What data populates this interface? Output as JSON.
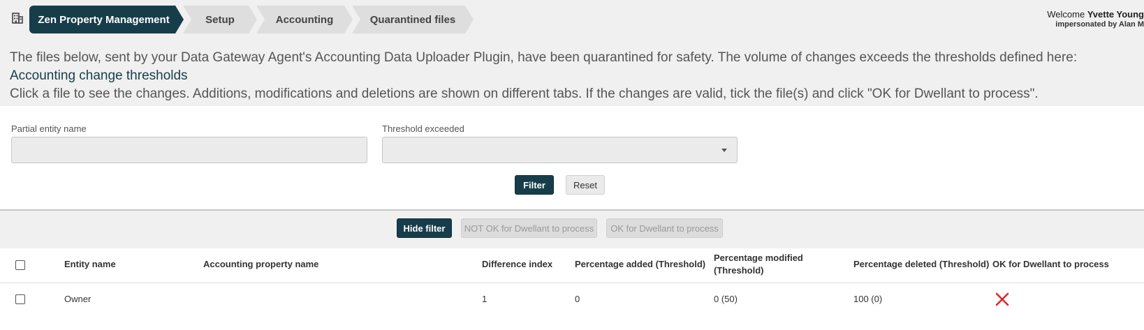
{
  "breadcrumb": {
    "items": [
      {
        "label": "Zen Property Management"
      },
      {
        "label": "Setup"
      },
      {
        "label": "Accounting"
      },
      {
        "label": "Quarantined files"
      }
    ]
  },
  "user": {
    "welcome_prefix": "Welcome",
    "name": "Yvette Young",
    "impersonated": "impersonated by Alan M"
  },
  "info": {
    "line1": "The files below, sent by your Data Gateway Agent's Accounting Data Uploader Plugin, have been quarantined for safety. The volume of changes exceeds the thresholds defined here:",
    "link": "Accounting change thresholds",
    "line2": "Click a file to see the changes. Additions, modifications and deletions are shown on different tabs. If the changes are valid, tick the file(s) and click \"OK for Dwellant to process\"."
  },
  "filter": {
    "entity_label": "Partial entity name",
    "entity_value": "",
    "threshold_label": "Threshold exceeded",
    "threshold_value": "",
    "filter_button": "Filter",
    "reset_button": "Reset"
  },
  "toolbar": {
    "hide_filter": "Hide filter",
    "not_ok": "NOT OK for Dwellant to process",
    "ok": "OK for Dwellant to process"
  },
  "table": {
    "columns": [
      "Entity name",
      "Accounting property name",
      "Difference index",
      "Percentage added (Threshold)",
      "Percentage modified (Threshold)",
      "Percentage deleted (Threshold)",
      "OK for Dwellant to process"
    ],
    "rows": [
      {
        "entity": "Owner",
        "property": "",
        "difference_index": "1",
        "added": "0",
        "modified": "0 (50)",
        "deleted": "100 (0)",
        "ok": false,
        "ok_icon": "red-x-icon"
      }
    ]
  },
  "colors": {
    "primary": "#173d4a",
    "danger": "#e0262b"
  }
}
